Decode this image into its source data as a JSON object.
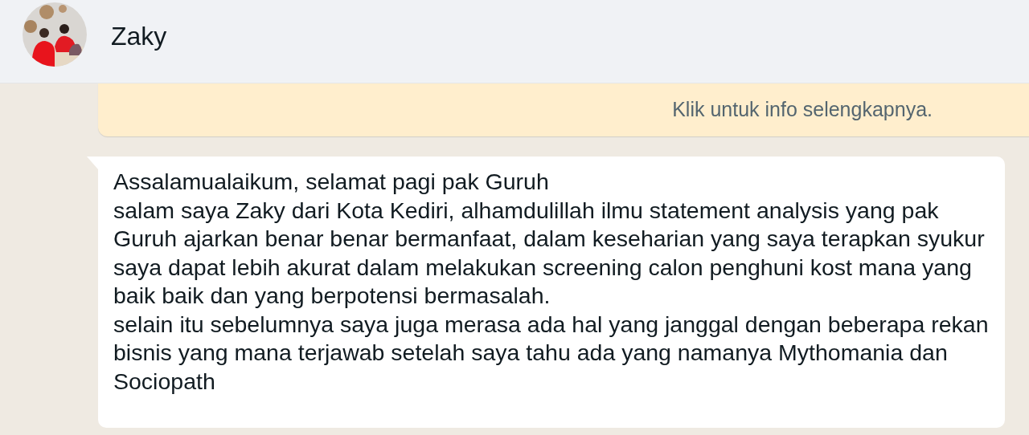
{
  "header": {
    "contact_name": "Zaky"
  },
  "notice": {
    "text": "Klik untuk info selengkapnya."
  },
  "message": {
    "paragraphs": [
      "Assalamualaikum, selamat pagi pak Guruh",
      "salam saya Zaky dari Kota Kediri, alhamdulillah ilmu statement analysis yang pak Guruh ajarkan benar benar bermanfaat, dalam keseharian yang saya terapkan syukur saya dapat lebih akurat dalam melakukan screening calon penghuni kost mana yang baik baik dan yang berpotensi bermasalah.",
      "selain itu sebelumnya saya juga merasa ada hal yang janggal dengan beberapa rekan bisnis yang mana terjawab setelah saya tahu ada yang namanya Mythomania dan Sociopath"
    ]
  }
}
